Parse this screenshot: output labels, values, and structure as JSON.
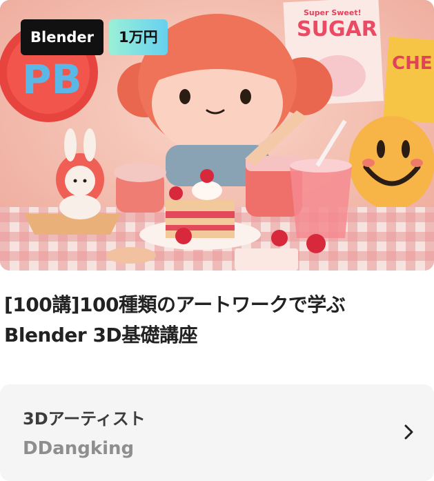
{
  "card": {
    "badges": {
      "software": "Blender",
      "price": "1万円"
    },
    "thumbnail": {
      "balloon_text": "PB",
      "poster_small": "Super Sweet!",
      "poster_title": "SUGAR",
      "poster_right": "CHE"
    },
    "title_lines": [
      "[100講]100種類のアートワークで学ぶ",
      "Blender 3D基礎講座"
    ],
    "instructor": {
      "role": "3Dアーティスト",
      "name": "DDangking"
    }
  }
}
